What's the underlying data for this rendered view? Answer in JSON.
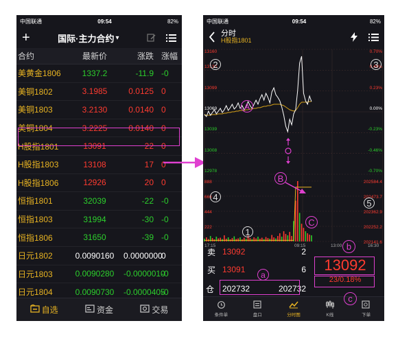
{
  "colors": {
    "up": "#ff3b30",
    "down": "#2ccf2c",
    "accent": "#e9b422",
    "annotation": "#e040d0",
    "avg_line": "#d4a017",
    "price_line": "#ffffff"
  },
  "left": {
    "status": {
      "carrier": "中国联通",
      "time": "09:54",
      "battery": "82%"
    },
    "nav": {
      "add_icon": "plus-icon",
      "title": "国际·主力合约",
      "title_arrow": "▾",
      "edit_icon": "edit-icon",
      "menu_icon": "menu-icon"
    },
    "headers": {
      "name": "合约",
      "price": "最新价",
      "change": "涨跌",
      "pct": "涨幅"
    },
    "rows": [
      {
        "name": "美黄金1806",
        "price": "1337.2",
        "change": "-11.9",
        "pct": "-0",
        "price_dir": "down",
        "chg_dir": "down"
      },
      {
        "name": "美铜1802",
        "price": "3.1985",
        "change": "0.0125",
        "pct": "0",
        "price_dir": "up",
        "chg_dir": "up"
      },
      {
        "name": "美铜1803",
        "price": "3.2130",
        "change": "0.0140",
        "pct": "0",
        "price_dir": "up",
        "chg_dir": "up"
      },
      {
        "name": "美铜1804",
        "price": "3.2225",
        "change": "0.0140",
        "pct": "0",
        "price_dir": "up",
        "chg_dir": "up"
      },
      {
        "name": "H股指1801",
        "price": "13091",
        "change": "22",
        "pct": "0",
        "price_dir": "up",
        "chg_dir": "up"
      },
      {
        "name": "H股指1803",
        "price": "13108",
        "change": "17",
        "pct": "0",
        "price_dir": "up",
        "chg_dir": "up"
      },
      {
        "name": "H股指1806",
        "price": "12926",
        "change": "20",
        "pct": "0",
        "price_dir": "up",
        "chg_dir": "up"
      },
      {
        "name": "恒指1801",
        "price": "32039",
        "change": "-22",
        "pct": "-0",
        "price_dir": "down",
        "chg_dir": "down"
      },
      {
        "name": "恒指1803",
        "price": "31994",
        "change": "-30",
        "pct": "-0",
        "price_dir": "down",
        "chg_dir": "down"
      },
      {
        "name": "恒指1806",
        "price": "31650",
        "change": "-39",
        "pct": "-0",
        "price_dir": "down",
        "chg_dir": "down"
      },
      {
        "name": "日元1802",
        "price": "0.0090160",
        "change": "0.0000000",
        "pct": "0",
        "price_dir": "white",
        "chg_dir": "white"
      },
      {
        "name": "日元1803",
        "price": "0.0090280",
        "change": "-0.0000010",
        "pct": "-0",
        "price_dir": "down",
        "chg_dir": "down"
      },
      {
        "name": "日元1804",
        "price": "0.0090730",
        "change": "-0.0000405",
        "pct": "-0",
        "price_dir": "down",
        "chg_dir": "down"
      }
    ],
    "tabs": [
      {
        "label": "自选",
        "icon": "watchlist-icon",
        "active": true
      },
      {
        "label": "资金",
        "icon": "wallet-icon",
        "active": false
      },
      {
        "label": "交易",
        "icon": "trade-icon",
        "active": false
      }
    ]
  },
  "right": {
    "status": {
      "carrier": "中国联通",
      "time": "09:54",
      "battery": "82%"
    },
    "nav": {
      "back_icon": "back-arrow-icon",
      "title": "分时",
      "subtitle": "H股指1801",
      "flash_icon": "lightning-icon",
      "menu_icon": "menu-icon"
    },
    "price_axis": [
      "13160",
      "13130",
      "13099",
      "13069",
      "13039",
      "13008",
      "12978"
    ],
    "pct_axis": [
      "0.70%",
      "0.46%",
      "0.23%",
      "0.00%",
      "-0.23%",
      "-0.46%",
      "-0.70%"
    ],
    "volume_axis": [
      "888",
      "666",
      "444",
      "222"
    ],
    "oi_axis": [
      "202584.4",
      "202473.7",
      "202362.9",
      "202252.2",
      "202141.6"
    ],
    "time_axis": [
      "17:15",
      "09:15",
      "13:00",
      "16:30"
    ],
    "annotations": {
      "a": "A",
      "b": "B",
      "c": "C",
      "n1": "1",
      "n2": "2",
      "n3": "3",
      "n4": "4",
      "n5": "5",
      "la": "a",
      "lb": "b",
      "lc": "c"
    },
    "chart_data": {
      "type": "line",
      "title": "",
      "prev_settle": 13069,
      "ylim": [
        12978,
        13160
      ],
      "price": [
        13065,
        13062,
        13070,
        13064,
        13068,
        13072,
        13066,
        13070,
        13074,
        13068,
        13072,
        13078,
        13071,
        13075,
        13080,
        13073,
        13076,
        13082,
        13074,
        13078,
        13072,
        13076,
        13084,
        13078,
        13074,
        13080,
        13086,
        13080,
        13088,
        13094,
        13086,
        13096,
        13090,
        13082,
        13098,
        13104,
        13094,
        13090,
        13085,
        13076,
        13064,
        13048,
        13040,
        13058,
        13050,
        13066,
        13072,
        13100,
        13140,
        13150,
        13096,
        13085,
        13080,
        13092,
        13084
      ],
      "avg": [
        13065,
        13064,
        13064,
        13064,
        13065,
        13065,
        13065,
        13066,
        13066,
        13066,
        13067,
        13067,
        13068,
        13068,
        13069,
        13069,
        13070,
        13070,
        13071,
        13071,
        13071,
        13072,
        13072,
        13073,
        13073,
        13074,
        13074,
        13075,
        13075,
        13076,
        13077,
        13077,
        13078,
        13078,
        13079,
        13080,
        13080,
        13080,
        13080,
        13079,
        13078,
        13076,
        13074,
        13072,
        13071,
        13070,
        13071,
        13075,
        13080,
        13083,
        13083,
        13083,
        13083,
        13084,
        13084
      ],
      "volume": [
        40,
        60,
        35,
        80,
        50,
        30,
        70,
        45,
        55,
        35,
        90,
        40,
        60,
        30,
        50,
        75,
        35,
        45,
        60,
        30,
        55,
        40,
        85,
        50,
        35,
        60,
        45,
        70,
        40,
        55,
        35,
        65,
        50,
        40,
        95,
        60,
        45,
        80,
        120,
        70,
        150,
        110,
        90,
        140,
        80,
        300,
        600,
        888,
        420,
        260,
        200,
        150,
        120,
        100,
        90
      ],
      "ylim_volume": [
        0,
        888
      ],
      "ylim_oi": [
        202141.6,
        202584.4
      ],
      "open_interest": [
        202150,
        202150,
        202150,
        202150,
        202150,
        202150,
        202150,
        202150,
        202150,
        202150,
        202150,
        202150,
        202150,
        202150,
        202150,
        202150,
        202150,
        202150,
        202150,
        202150,
        202150,
        202150,
        202150,
        202150,
        202150,
        202150,
        202150,
        202150,
        202150,
        202150,
        202150,
        202150,
        202150,
        202150,
        202150,
        202150,
        202150,
        202150,
        202150,
        202150,
        202150,
        202150,
        202150,
        202150,
        202150,
        202150,
        202540,
        202540,
        202540,
        202540,
        202540,
        202540,
        202540,
        202540,
        202540
      ]
    },
    "quote": {
      "sell_label": "卖",
      "sell_price": "13092",
      "sell_qty": "2",
      "buy_label": "买",
      "buy_price": "13091",
      "buy_qty": "6",
      "oi_label": "仓",
      "oi_value1": "202732",
      "oi_value2": "202732",
      "last_price": "13092",
      "change": "23/0.18%"
    },
    "tabs": [
      {
        "label": "条件单",
        "icon": "alarm-icon",
        "active": false
      },
      {
        "label": "盘口",
        "icon": "orderbook-icon",
        "active": false
      },
      {
        "label": "分时图",
        "icon": "intraday-chart-icon",
        "active": true
      },
      {
        "label": "K线",
        "icon": "candlestick-icon",
        "active": false
      },
      {
        "label": "下单",
        "icon": "place-order-icon",
        "active": false
      }
    ]
  }
}
